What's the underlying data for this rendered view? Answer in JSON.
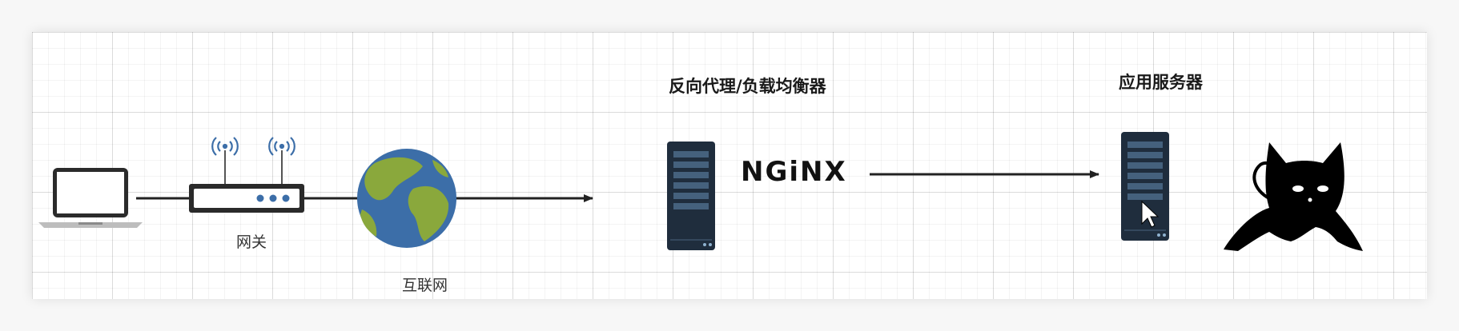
{
  "nodes": {
    "gateway": {
      "label": "网关"
    },
    "internet": {
      "label": "互联网"
    },
    "proxy": {
      "label": "反向代理/负载均衡器",
      "logo_text": "NGiNX"
    },
    "app": {
      "label": "应用服务器"
    }
  },
  "icons": [
    "laptop-icon",
    "router-icon",
    "globe-icon",
    "server-icon",
    "nginx-logo",
    "tomcat-icon"
  ],
  "colors": {
    "globe_ocean": "#3c6ea8",
    "globe_land": "#8aa83c",
    "server_body": "#1f2d3d",
    "server_bar": "#45617d",
    "edge": "#222222"
  }
}
